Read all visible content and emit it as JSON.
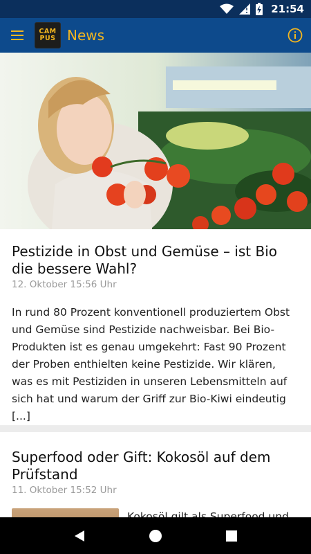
{
  "status_bar": {
    "time": "21:54"
  },
  "app_bar": {
    "logo_line1": "CAM",
    "logo_line2": "PUS",
    "title": "News"
  },
  "articles": [
    {
      "headline": "Pestizide in Obst und Gemüse – ist Bio die bessere Wahl?",
      "date": "12. Oktober 15:56 Uhr",
      "excerpt": "In rund 80 Prozent konventionell produziertem Obst und Gemüse sind Pestizide nachweisbar. Bei Bio-Produkten ist es genau umgekehrt: Fast 90 Prozent der Proben enthielten keine Pestizide. Wir klären, was es mit Pestiziden in unseren Lebensmitteln auf sich hat und warum der Griff zur Bio-Kiwi eindeutig [...]"
    },
    {
      "headline": "Superfood oder Gift: Kokosöl auf dem Prüfstand",
      "date": "11. Oktober 15:52 Uhr",
      "excerpt": "Kokosöl gilt als Superfood und"
    }
  ],
  "colors": {
    "status_bar": "#0b2f5c",
    "app_bar": "#0d4a8c",
    "accent": "#f3b61f",
    "nav_bar": "#000000"
  }
}
